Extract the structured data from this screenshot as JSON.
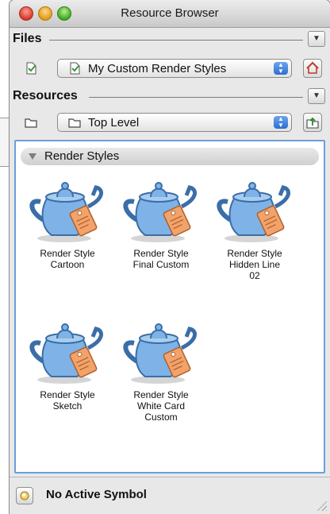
{
  "window": {
    "title": "Resource Browser"
  },
  "files": {
    "label": "Files",
    "popup_value": "My Custom Render Styles"
  },
  "resources": {
    "label": "Resources",
    "popup_value": "Top Level"
  },
  "group": {
    "label": "Render Styles"
  },
  "items": [
    {
      "label": "Render Style\nCartoon"
    },
    {
      "label": "Render Style\nFinal Custom"
    },
    {
      "label": "Render Style\nHidden Line\n02"
    },
    {
      "label": "Render Style\nSketch"
    },
    {
      "label": "Render Style\nWhite Card\nCustom"
    }
  ],
  "status": {
    "text": "No Active Symbol"
  },
  "colors": {
    "selection_border": "#6d9ed8",
    "teapot": "#7fb2e6",
    "tag": "#f2a36b"
  }
}
